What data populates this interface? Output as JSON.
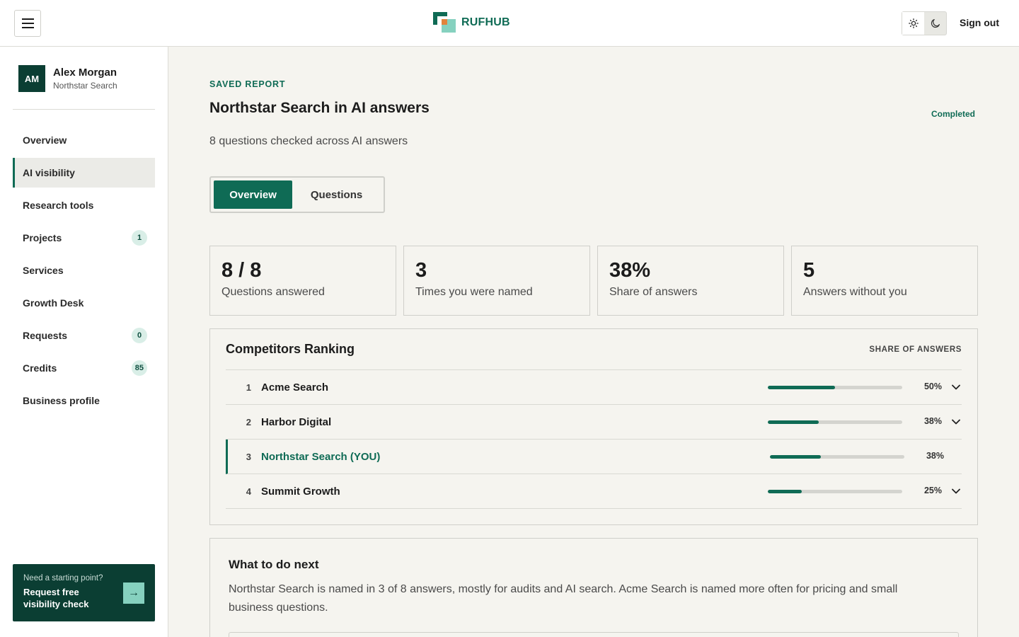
{
  "brand": {
    "logo_part1": "RUF",
    "logo_part2": "HUB"
  },
  "header": {
    "signout_label": "Sign out",
    "theme_light_icon": "sun-icon",
    "theme_dark_icon": "moon-icon"
  },
  "user": {
    "initials": "AM",
    "name": "Alex Morgan",
    "org": "Northstar Search"
  },
  "sidebar": {
    "items": [
      {
        "label": "Overview",
        "badge": null,
        "active": false
      },
      {
        "label": "AI visibility",
        "badge": null,
        "active": true
      },
      {
        "label": "Research tools",
        "badge": null,
        "active": false
      },
      {
        "label": "Projects",
        "badge": "1",
        "active": false
      },
      {
        "label": "Services",
        "badge": null,
        "active": false
      },
      {
        "label": "Growth Desk",
        "badge": null,
        "active": false
      },
      {
        "label": "Requests",
        "badge": "0",
        "active": false
      },
      {
        "label": "Credits",
        "badge": "85",
        "active": false
      },
      {
        "label": "Business profile",
        "badge": null,
        "active": false
      }
    ],
    "promo": {
      "small": "Need a starting point?",
      "big": "Request free visibility check",
      "arrow": "→"
    }
  },
  "report": {
    "eyebrow": "SAVED REPORT",
    "title": "Northstar Search in AI answers",
    "status": "Completed",
    "subtitle": "8 questions checked across AI answers",
    "tabs": [
      {
        "label": "Overview",
        "active": true
      },
      {
        "label": "Questions",
        "active": false
      }
    ]
  },
  "stats": [
    {
      "value": "8 / 8",
      "label": "Questions answered"
    },
    {
      "value": "3",
      "label": "Times you were named"
    },
    {
      "value": "38%",
      "label": "Share of answers"
    },
    {
      "value": "5",
      "label": "Answers without you"
    }
  ],
  "ranking": {
    "title": "Competitors Ranking",
    "column": "SHARE OF ANSWERS",
    "rows": [
      {
        "rank": "1",
        "name": "Acme Search",
        "share": 0.5,
        "share_label": "50%",
        "you": false,
        "expandable": true
      },
      {
        "rank": "2",
        "name": "Harbor Digital",
        "share": 0.38,
        "share_label": "38%",
        "you": false,
        "expandable": true
      },
      {
        "rank": "3",
        "name": "Northstar Search (YOU)",
        "share": 0.38,
        "share_label": "38%",
        "you": true,
        "expandable": false
      },
      {
        "rank": "4",
        "name": "Summit Growth",
        "share": 0.25,
        "share_label": "25%",
        "you": false,
        "expandable": true
      }
    ]
  },
  "next": {
    "title": "What to do next",
    "body": "Northstar Search is named in 3 of 8 answers, mostly for audits and AI search. Acme Search is named more often for pricing and small business questions."
  },
  "colors": {
    "accent": "#0f6b55",
    "dark": "#0b3e33",
    "mint": "#86d1bf",
    "background": "#f5f4ef"
  }
}
